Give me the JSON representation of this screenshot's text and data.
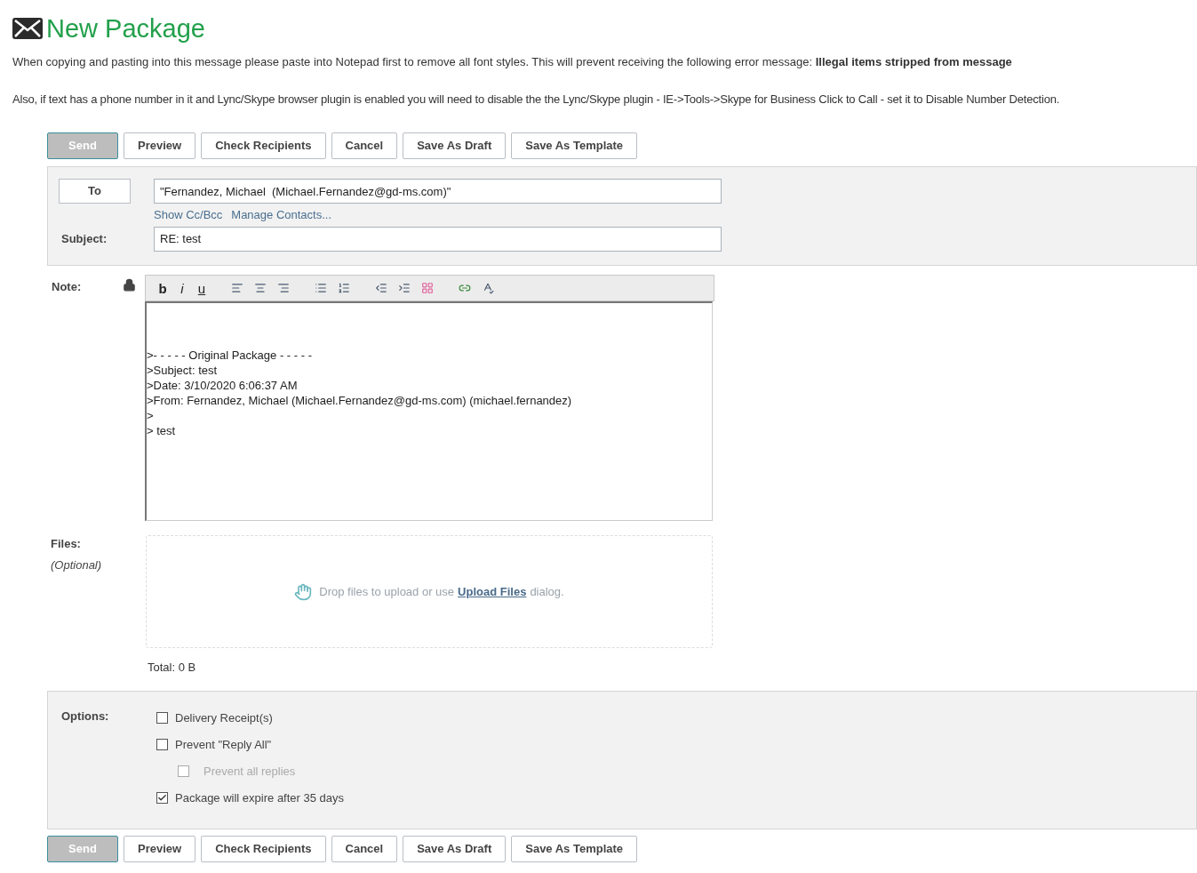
{
  "title": "New Package",
  "notices": [
    "When copying and pasting into this message please paste into Notepad first to remove all font styles. This will prevent receiving the following error message: **Illegal items stripped from message**",
    "Also, if text has a phone number in it and Lync/Skype browser plugin is enabled you will need to disable the the Lync/Skype plugin - IE->Tools->Skype for Business Click to Call - set it to Disable Number Detection."
  ],
  "buttons_top": [
    {
      "label": "Send",
      "kind": "primary"
    },
    {
      "label": "Preview",
      "kind": "default"
    },
    {
      "label": "Check Recipients",
      "kind": "default"
    },
    {
      "label": "Cancel",
      "kind": "default"
    },
    {
      "label": "Save As Draft",
      "kind": "default"
    },
    {
      "label": "Save As Template",
      "kind": "default"
    }
  ],
  "recipients": {
    "to_button": "To",
    "to_value": "\"Fernandez, Michael  (Michael.Fernandez@gd-ms.com)\"",
    "links": [
      "Show Cc/Bcc",
      "Manage Contacts..."
    ],
    "subject_label": "Subject:",
    "subject_value": "RE: test"
  },
  "note": {
    "label": "Note:",
    "toolbar": [
      {
        "kind": "bold",
        "label": "b"
      },
      {
        "kind": "italic",
        "label": "i"
      },
      {
        "kind": "underline",
        "label": "u"
      },
      {
        "kind": "align-left"
      },
      {
        "kind": "align-center"
      },
      {
        "kind": "align-right"
      },
      {
        "kind": "bullets"
      },
      {
        "kind": "numbers"
      },
      {
        "kind": "outdent"
      },
      {
        "kind": "indent"
      },
      {
        "kind": "colors"
      },
      {
        "kind": "link"
      },
      {
        "kind": "spellcheck"
      }
    ],
    "lines": [
      ">- - - - - Original Package - - - - -",
      ">Subject: test",
      ">Date: 3/10/2020 6:06:37 AM",
      ">From: Fernandez, Michael (Michael.Fernandez@gd-ms.com) (michael.fernandez)",
      ">",
      "> test"
    ]
  },
  "files": {
    "label": "Files:",
    "hint": "(Optional)",
    "drop_text": "Drop files to upload or use",
    "link": "Upload Files",
    "drop_tail": "dialog.",
    "total": "Total: 0 B"
  },
  "options": {
    "label": "Options:",
    "items": [
      {
        "label": "Delivery Receipt(s)",
        "checked": false,
        "disabled": false
      },
      {
        "label": "Prevent \"Reply All\"",
        "checked": false,
        "disabled": false,
        "children": [
          {
            "label": "Prevent all replies",
            "checked": false,
            "disabled": true
          }
        ]
      },
      {
        "label": "Package will expire after 35 days",
        "checked": true,
        "disabled": false
      }
    ]
  },
  "buttons_bottom": [
    {
      "label": "Send",
      "kind": "primary"
    },
    {
      "label": "Preview",
      "kind": "default"
    },
    {
      "label": "Check Recipients",
      "kind": "default"
    },
    {
      "label": "Cancel",
      "kind": "default"
    },
    {
      "label": "Save As Draft",
      "kind": "default"
    },
    {
      "label": "Save As Template",
      "kind": "default"
    }
  ]
}
